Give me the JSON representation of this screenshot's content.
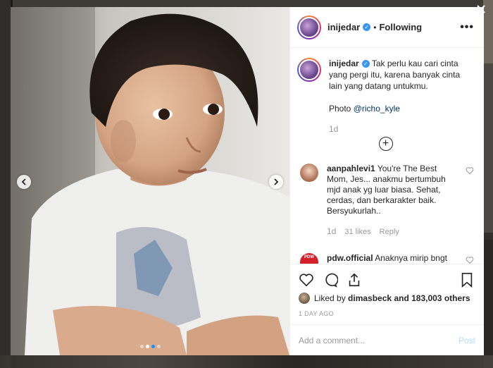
{
  "post": {
    "username": "inijedar",
    "follow_status": "Following",
    "caption": "Tak perlu kau cari cinta yang pergi itu, karena banyak cinta lain yang datang untukmu.",
    "photo_credit_prefix": "Photo",
    "photo_credit_handle": "@richo_kyle",
    "caption_age": "1d",
    "likes_prefix": "Liked by",
    "liked_by_user": "dimasbeck",
    "likes_suffix": "and 183,003 others",
    "post_age": "1 DAY AGO",
    "comment_placeholder": "Add a comment...",
    "post_button": "Post",
    "carousel": {
      "slides": 4,
      "active_index": 2
    }
  },
  "comments": [
    {
      "username": "aanpahlevi1",
      "text": "You're The Best Mom, Jes... anakmu bertumbuh mjd anak yg luar biasa. Sehat, cerdas, dan berkarakter baik. Bersyukurlah..",
      "age": "1d",
      "likes": "31 likes",
      "reply": "Reply"
    },
    {
      "username": "pdw.official",
      "text": "Anaknya mirip bngt",
      "badge": "PDW"
    }
  ],
  "colors": {
    "link": "#003569",
    "verified": "#3897f0",
    "muted": "#999999",
    "post_disabled": "#b2dffc"
  }
}
